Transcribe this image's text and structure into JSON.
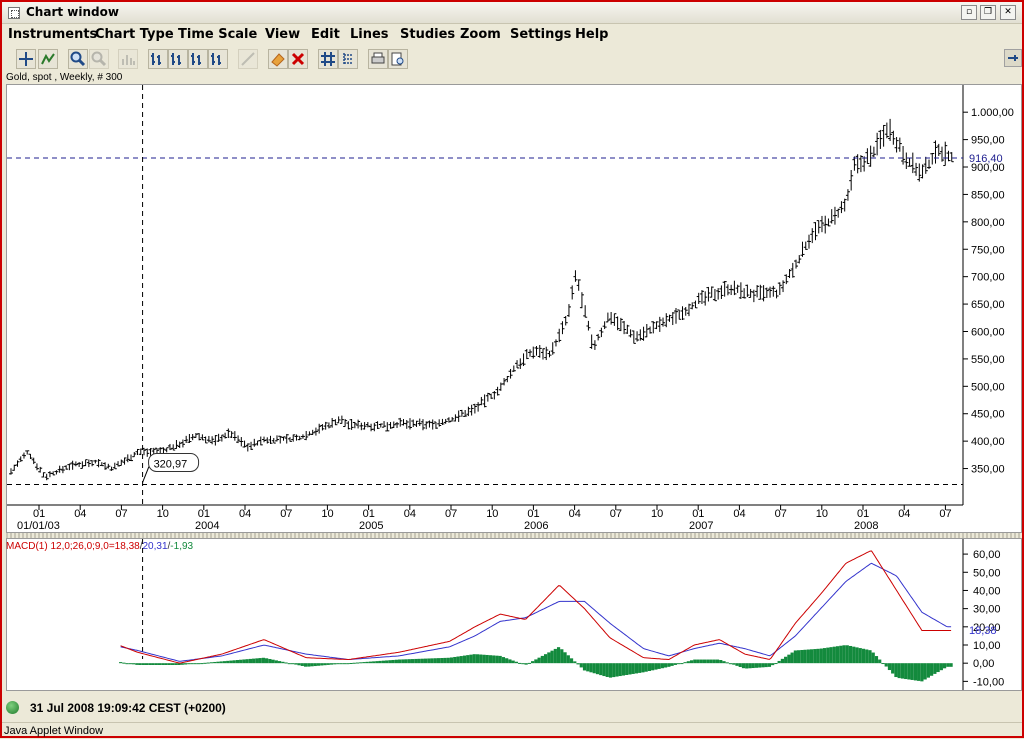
{
  "window": {
    "title": "Chart window"
  },
  "menu": [
    "Instruments",
    "Chart Type",
    "Time Scale",
    "View",
    "Edit",
    "Lines",
    "Studies",
    "Zoom",
    "Settings",
    "Help"
  ],
  "toolbar": {
    "icons": [
      "crosshair-icon",
      "navigate-icon",
      "zoom-in-icon",
      "zoom-out-icon",
      "bar-chart-icon",
      "bars-icon-1",
      "bars-icon-2",
      "bars-icon-3",
      "bars-icon-4",
      "drawing-icon",
      "eraser-icon",
      "delete-icon",
      "grid-icon",
      "grid-settings-icon",
      "print-icon",
      "print-preview-icon"
    ]
  },
  "chart_label": "Gold, spot , Weekly, # 300",
  "colors": {
    "accent_red": "#cc0000",
    "macd_line": "#cc0000",
    "signal_line": "#3333cc",
    "histogram": "#138a3d",
    "current_price": "#1f1f8f"
  },
  "chart_data": [
    {
      "type": "ohlc",
      "title": "Gold, spot , Weekly, # 300",
      "ylim": [
        320,
        1035
      ],
      "y_ticks": [
        "350,00",
        "400,00",
        "450,00",
        "500,00",
        "550,00",
        "600,00",
        "650,00",
        "700,00",
        "750,00",
        "800,00",
        "850,00",
        "900,00",
        "950,00",
        "1.000,00"
      ],
      "current_price_label": "916,40",
      "current_price": 916.4,
      "low_marker_label": "320,97",
      "low_marker": 320.97,
      "x_ticks": [
        "01",
        "04",
        "07",
        "10",
        "01",
        "04",
        "07",
        "10",
        "01",
        "04",
        "07",
        "10",
        "01",
        "04",
        "07",
        "10",
        "01",
        "04",
        "07",
        "10",
        "01",
        "04",
        "07"
      ],
      "x_year_labels": [
        "01/01/03",
        "2004",
        "2005",
        "2006",
        "2007",
        "2008"
      ],
      "weekly_close_points": [
        [
          2003.0,
          345
        ],
        [
          2003.1,
          380
        ],
        [
          2003.2,
          335
        ],
        [
          2003.35,
          355
        ],
        [
          2003.5,
          363
        ],
        [
          2003.6,
          350
        ],
        [
          2003.75,
          380
        ],
        [
          2003.9,
          382
        ],
        [
          2004.0,
          395
        ],
        [
          2004.1,
          410
        ],
        [
          2004.2,
          400
        ],
        [
          2004.3,
          415
        ],
        [
          2004.4,
          390
        ],
        [
          2004.5,
          402
        ],
        [
          2004.7,
          405
        ],
        [
          2004.85,
          425
        ],
        [
          2004.95,
          440
        ],
        [
          2005.0,
          430
        ],
        [
          2005.2,
          428
        ],
        [
          2005.3,
          432
        ],
        [
          2005.5,
          430
        ],
        [
          2005.6,
          438
        ],
        [
          2005.75,
          460
        ],
        [
          2005.9,
          495
        ],
        [
          2006.0,
          540
        ],
        [
          2006.1,
          565
        ],
        [
          2006.2,
          560
        ],
        [
          2006.3,
          625
        ],
        [
          2006.35,
          705
        ],
        [
          2006.45,
          570
        ],
        [
          2006.55,
          630
        ],
        [
          2006.7,
          590
        ],
        [
          2006.8,
          605
        ],
        [
          2006.95,
          630
        ],
        [
          2007.0,
          640
        ],
        [
          2007.1,
          660
        ],
        [
          2007.25,
          680
        ],
        [
          2007.4,
          668
        ],
        [
          2007.55,
          670
        ],
        [
          2007.65,
          720
        ],
        [
          2007.75,
          780
        ],
        [
          2007.85,
          800
        ],
        [
          2007.95,
          830
        ],
        [
          2008.0,
          900
        ],
        [
          2008.1,
          920
        ],
        [
          2008.2,
          975
        ],
        [
          2008.3,
          920
        ],
        [
          2008.4,
          885
        ],
        [
          2008.5,
          935
        ],
        [
          2008.55,
          920
        ]
      ]
    },
    {
      "type": "line",
      "title": "MACD(1) 12,0;26,0;9,0",
      "legend": {
        "name": "MACD(1) 12,0;26,0;9,0",
        "macd": "18,38",
        "signal": "20,31",
        "hist": "-1,93"
      },
      "ylim": [
        -12,
        65
      ],
      "y_ticks": [
        "-10,00",
        "0,00",
        "10,00",
        "20,00",
        "30,00",
        "40,00",
        "50,00",
        "60,00"
      ],
      "last_value_label": "18,38",
      "series": [
        {
          "name": "MACD",
          "values": [
            [
              2003.0,
              2
            ],
            [
              2003.25,
              9
            ],
            [
              2003.5,
              15
            ],
            [
              2003.75,
              6
            ],
            [
              2004.0,
              0
            ],
            [
              2004.25,
              5
            ],
            [
              2004.5,
              13
            ],
            [
              2004.75,
              3
            ],
            [
              2005.0,
              2
            ],
            [
              2005.3,
              6
            ],
            [
              2005.6,
              12
            ],
            [
              2005.75,
              20
            ],
            [
              2005.9,
              27
            ],
            [
              2006.05,
              24
            ],
            [
              2006.25,
              43
            ],
            [
              2006.4,
              30
            ],
            [
              2006.55,
              14
            ],
            [
              2006.75,
              3
            ],
            [
              2006.9,
              2
            ],
            [
              2007.05,
              10
            ],
            [
              2007.2,
              13
            ],
            [
              2007.35,
              5
            ],
            [
              2007.5,
              2
            ],
            [
              2007.65,
              22
            ],
            [
              2007.8,
              38
            ],
            [
              2007.95,
              55
            ],
            [
              2008.1,
              62
            ],
            [
              2008.25,
              40
            ],
            [
              2008.4,
              18
            ],
            [
              2008.55,
              18
            ]
          ]
        },
        {
          "name": "Signal",
          "values": [
            [
              2003.0,
              1
            ],
            [
              2003.25,
              7
            ],
            [
              2003.5,
              12
            ],
            [
              2003.75,
              7
            ],
            [
              2004.0,
              1
            ],
            [
              2004.25,
              4
            ],
            [
              2004.5,
              10
            ],
            [
              2004.75,
              5
            ],
            [
              2005.0,
              2
            ],
            [
              2005.3,
              4
            ],
            [
              2005.6,
              9
            ],
            [
              2005.75,
              15
            ],
            [
              2005.9,
              23
            ],
            [
              2006.05,
              25
            ],
            [
              2006.25,
              34
            ],
            [
              2006.4,
              34
            ],
            [
              2006.55,
              22
            ],
            [
              2006.75,
              8
            ],
            [
              2006.9,
              4
            ],
            [
              2007.05,
              8
            ],
            [
              2007.2,
              11
            ],
            [
              2007.35,
              8
            ],
            [
              2007.5,
              4
            ],
            [
              2007.65,
              15
            ],
            [
              2007.8,
              30
            ],
            [
              2007.95,
              45
            ],
            [
              2008.1,
              55
            ],
            [
              2008.25,
              48
            ],
            [
              2008.4,
              28
            ],
            [
              2008.55,
              20
            ]
          ]
        }
      ]
    }
  ],
  "status": {
    "datetime": "31 Jul 2008 19:09:42  CEST (+0200)"
  },
  "applet": "Java Applet Window"
}
